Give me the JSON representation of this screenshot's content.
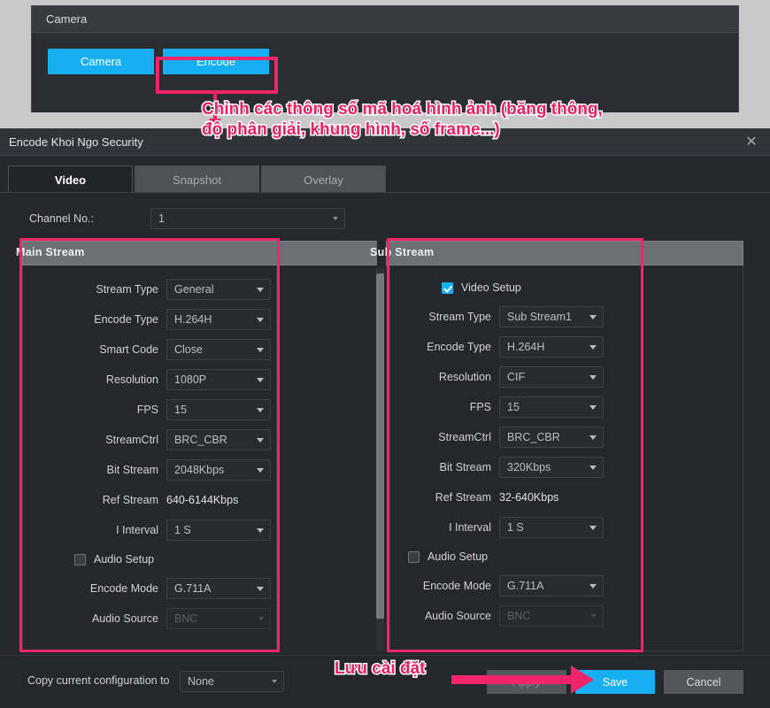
{
  "background_color": "#c9c9c9",
  "accent_blue": "#16b0f2",
  "annotation_pink": "#ec1f63",
  "camera_window": {
    "title": "Camera",
    "buttons": [
      {
        "label": "Camera",
        "name": "camera-button"
      },
      {
        "label": "Encode",
        "name": "encode-button"
      }
    ]
  },
  "annotations": {
    "encode_note_line1": "Chỉnh các thông số mã hoá hình ảnh (băng thông,",
    "encode_note_line2": "độ phân giải, khung hình, số frame...)",
    "save_note": "Lưu cài đặt"
  },
  "dialog": {
    "title": "Encode Khoi Ngo Security",
    "close_icon": "close-icon",
    "close_glyph": "✕",
    "tabs": [
      {
        "label": "Video",
        "active": true
      },
      {
        "label": "Snapshot",
        "active": false
      },
      {
        "label": "Overlay",
        "active": false
      }
    ],
    "channel": {
      "label": "Channel No.:",
      "value": "1"
    },
    "main_stream": {
      "title": "Main Stream",
      "fields": [
        {
          "label": "Stream Type",
          "value": "General",
          "type": "select"
        },
        {
          "label": "Encode Type",
          "value": "H.264H",
          "type": "select"
        },
        {
          "label": "Smart Code",
          "value": "Close",
          "type": "select"
        },
        {
          "label": "Resolution",
          "value": "1080P",
          "type": "select"
        },
        {
          "label": "FPS",
          "value": "15",
          "type": "select"
        },
        {
          "label": "StreamCtrl",
          "value": "BRC_CBR",
          "type": "select"
        },
        {
          "label": "Bit Stream",
          "value": "2048Kbps",
          "type": "select"
        },
        {
          "label": "Ref Stream",
          "value": "640-6144Kbps",
          "type": "text"
        },
        {
          "label": "I Interval",
          "value": "1 S",
          "type": "select"
        }
      ],
      "audio_setup": {
        "label": "Audio Setup",
        "checked": false
      },
      "audio_fields": [
        {
          "label": "Encode Mode",
          "value": "G.711A",
          "type": "select",
          "disabled": false
        },
        {
          "label": "Audio Source",
          "value": "BNC",
          "type": "select",
          "disabled": true
        }
      ]
    },
    "sub_stream": {
      "title": "Sub Stream",
      "video_setup": {
        "label": "Video Setup",
        "checked": true
      },
      "fields": [
        {
          "label": "Stream Type",
          "value": "Sub Stream1",
          "type": "select"
        },
        {
          "label": "Encode Type",
          "value": "H.264H",
          "type": "select"
        },
        {
          "label": "Resolution",
          "value": "CIF",
          "type": "select"
        },
        {
          "label": "FPS",
          "value": "15",
          "type": "select"
        },
        {
          "label": "StreamCtrl",
          "value": "BRC_CBR",
          "type": "select"
        },
        {
          "label": "Bit Stream",
          "value": "320Kbps",
          "type": "select"
        },
        {
          "label": "Ref Stream",
          "value": "32-640Kbps",
          "type": "text"
        },
        {
          "label": "I Interval",
          "value": "1 S",
          "type": "select"
        }
      ],
      "audio_setup": {
        "label": "Audio Setup",
        "checked": false
      },
      "audio_fields": [
        {
          "label": "Encode Mode",
          "value": "G.711A",
          "type": "select",
          "disabled": false
        },
        {
          "label": "Audio Source",
          "value": "BNC",
          "type": "select",
          "disabled": true
        }
      ]
    },
    "footer": {
      "copy_label": "Copy current configuration to",
      "copy_value": "None",
      "apply_label": "Apply",
      "save_label": "Save",
      "cancel_label": "Cancel"
    }
  }
}
